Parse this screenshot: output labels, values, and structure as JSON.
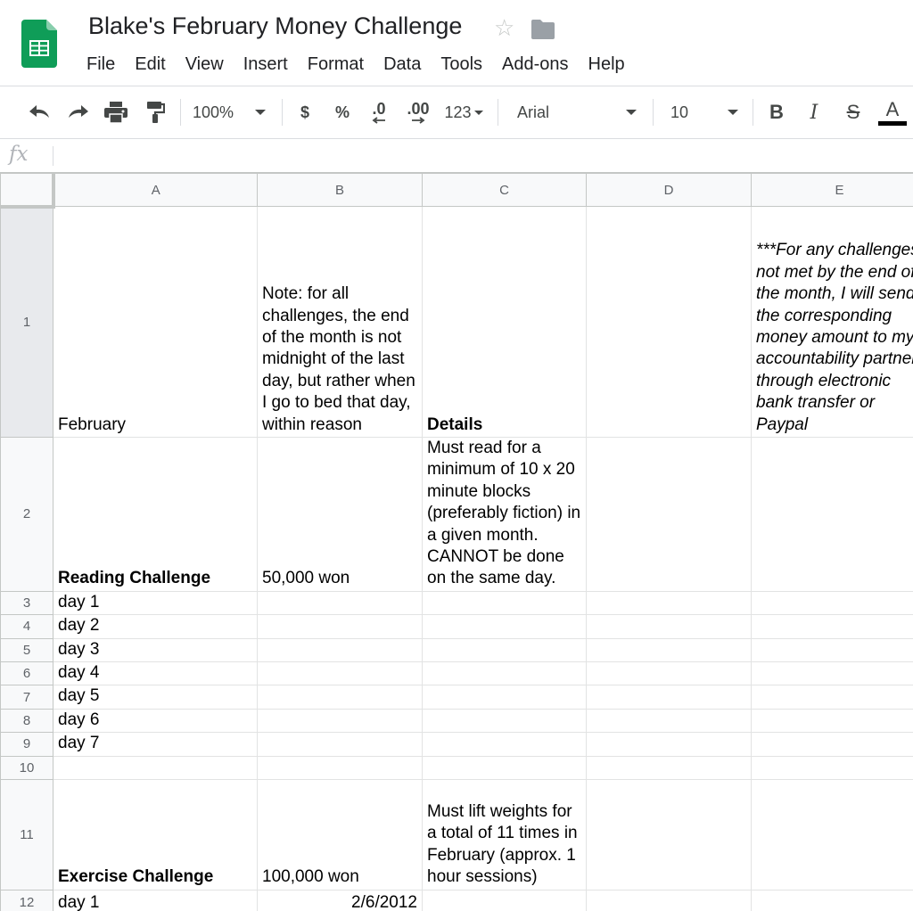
{
  "app": {
    "title": "Blake's February Money Challenge",
    "menu": [
      "File",
      "Edit",
      "View",
      "Insert",
      "Format",
      "Data",
      "Tools",
      "Add-ons",
      "Help"
    ],
    "brand_color": "#0f9d58"
  },
  "toolbar": {
    "zoom": "100%",
    "currency": "$",
    "percent": "%",
    "decrease_decimal": ".0",
    "increase_decimal": ".00",
    "more_formats": "123",
    "font": "Arial",
    "font_size": "10",
    "bold": "B",
    "italic": "I",
    "strikethrough": "S",
    "text_color": "A"
  },
  "formula_bar": {
    "label": "fx",
    "value": ""
  },
  "grid": {
    "column_headers": [
      "A",
      "B",
      "C",
      "D",
      "E"
    ],
    "row_numbers": [
      "1",
      "2",
      "3",
      "4",
      "5",
      "6",
      "7",
      "8",
      "9",
      "10",
      "11",
      "12"
    ],
    "cells": {
      "A1": "February",
      "B1": "Note: for all challenges, the end of the month is not midnight of the last day, but rather when I go to bed that day, within reason",
      "C1": "Details",
      "E1": "***For any challenges not met by the end of the month, I will send the corresponding money amount to my accountability partner through electronic bank transfer or Paypal",
      "A2": "Reading Challenge",
      "B2": "50,000 won",
      "C2": "Must read for a minimum of 10 x 20 minute blocks (preferably fiction) in a given month. CANNOT be done on the same day.",
      "A3": "day 1",
      "A4": "day 2",
      "A5": "day 3",
      "A6": "day 4",
      "A7": "day 5",
      "A8": "day 6",
      "A9": "day 7",
      "A11": "Exercise Challenge",
      "B11": "100,000 won",
      "C11": "Must lift weights for a total of 11 times in February (approx. 1 hour sessions)",
      "A12": "day 1",
      "B12": "2/6/2012"
    }
  }
}
